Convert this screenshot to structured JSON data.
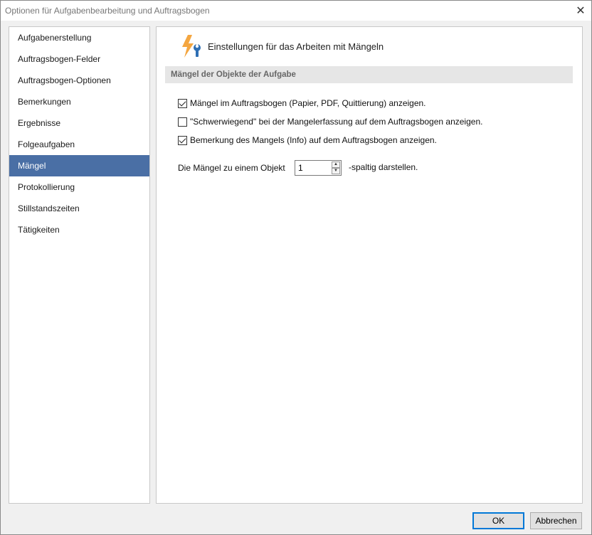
{
  "window": {
    "title": "Optionen für Aufgabenbearbeitung und Auftragsbogen",
    "close_glyph": "✕"
  },
  "sidebar": {
    "items": [
      {
        "label": "Aufgabenerstellung"
      },
      {
        "label": "Auftragsbogen-Felder"
      },
      {
        "label": "Auftragsbogen-Optionen"
      },
      {
        "label": "Bemerkungen"
      },
      {
        "label": "Ergebnisse"
      },
      {
        "label": "Folgeaufgaben"
      },
      {
        "label": "Mängel",
        "active": true
      },
      {
        "label": "Protokollierung"
      },
      {
        "label": "Stillstandszeiten"
      },
      {
        "label": "Tätigkeiten"
      }
    ],
    "active_color": "#4a6fa5"
  },
  "content": {
    "header_title": "Einstellungen für das Arbeiten mit Mängeln",
    "header_icon": "lightning-wrench-icon",
    "section_title": "Mängel der Objekte der Aufgabe",
    "options": [
      {
        "label": "Mängel im Auftragsbogen (Papier, PDF, Quittierung) anzeigen.",
        "checked": true
      },
      {
        "label": "\"Schwerwiegend\" bei der Mangelerfassung auf dem Auftragsbogen anzeigen.",
        "checked": false
      },
      {
        "label": "Bemerkung des Mangels (Info) auf dem Auftragsbogen anzeigen.",
        "checked": true
      }
    ],
    "columns": {
      "prefix": "Die Mängel zu einem Objekt",
      "value": "1",
      "suffix": "-spaltig darstellen.",
      "up_glyph": "▲",
      "down_glyph": "▼"
    }
  },
  "footer": {
    "ok_label": "OK",
    "cancel_label": "Abbrechen"
  }
}
